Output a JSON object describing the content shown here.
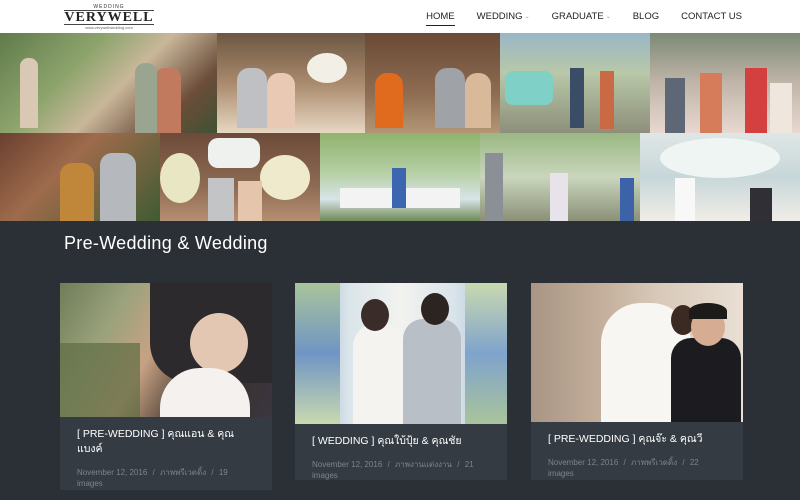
{
  "brand": {
    "top": "WEDDING",
    "name": "VERYWELL",
    "sub": "www.verywellwedding.com"
  },
  "nav": [
    {
      "label": "HOME",
      "active": true
    },
    {
      "label": "WEDDING"
    },
    {
      "label": "GRADUATE"
    },
    {
      "label": "BLOG"
    },
    {
      "label": "CONTACT US"
    }
  ],
  "section": {
    "title": "Pre-Wedding & Wedding"
  },
  "cards": [
    {
      "title": "[ PRE-WEDDING ] คุณแอน & คุณแบงค์",
      "date": "November 12, 2016",
      "category": "ภาพพรีเวดดิ้ง",
      "count": "19 images"
    },
    {
      "title": "[ WEDDING ] คุณใบ้ปุ้ย & คุณชัย",
      "date": "November 12, 2016",
      "category": "ภาพงานแต่งงาน",
      "count": "21 images"
    },
    {
      "title": "[ PRE-WEDDING ] คุณจ๊ะ & คุณวี",
      "date": "November 12, 2016",
      "category": "ภาพพรีเวดดิ้ง",
      "count": "22 images"
    }
  ],
  "meta_separator": "/"
}
